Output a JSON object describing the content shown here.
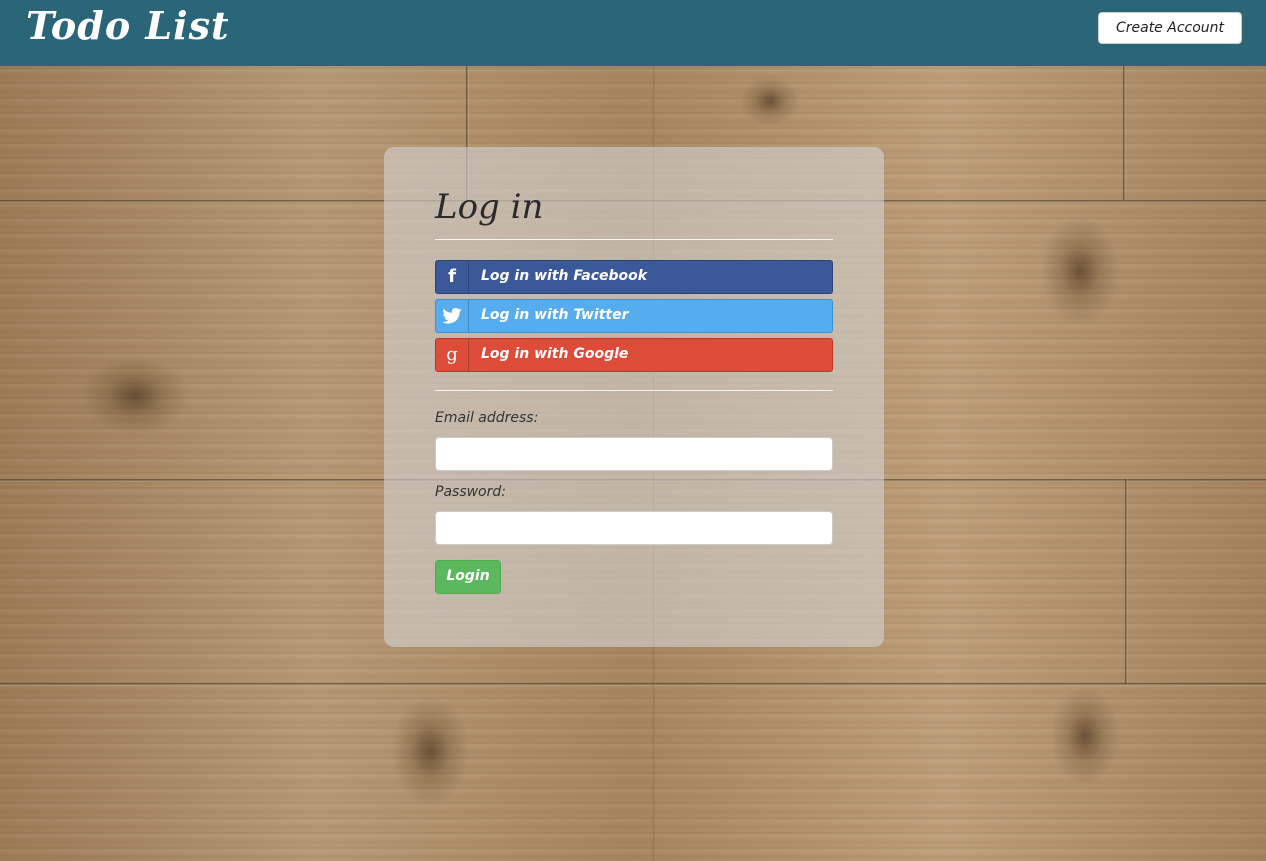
{
  "navbar": {
    "brand": "Todo List",
    "create_account_label": "Create Account"
  },
  "login_card": {
    "title": "Log in",
    "social": [
      {
        "label": "Log in with Facebook",
        "icon": "facebook-icon",
        "glyph": "f",
        "color": "#3b5998"
      },
      {
        "label": "Log in with Twitter",
        "icon": "twitter-icon",
        "glyph": "t",
        "color": "#55acee"
      },
      {
        "label": "Log in with Google",
        "icon": "google-icon",
        "glyph": "g",
        "color": "#dd4b39"
      }
    ],
    "email_label": "Email address:",
    "email_value": "",
    "password_label": "Password:",
    "password_value": "",
    "login_label": "Login"
  },
  "colors": {
    "navbar": "#2a6678",
    "login_button": "#5cb85c"
  }
}
